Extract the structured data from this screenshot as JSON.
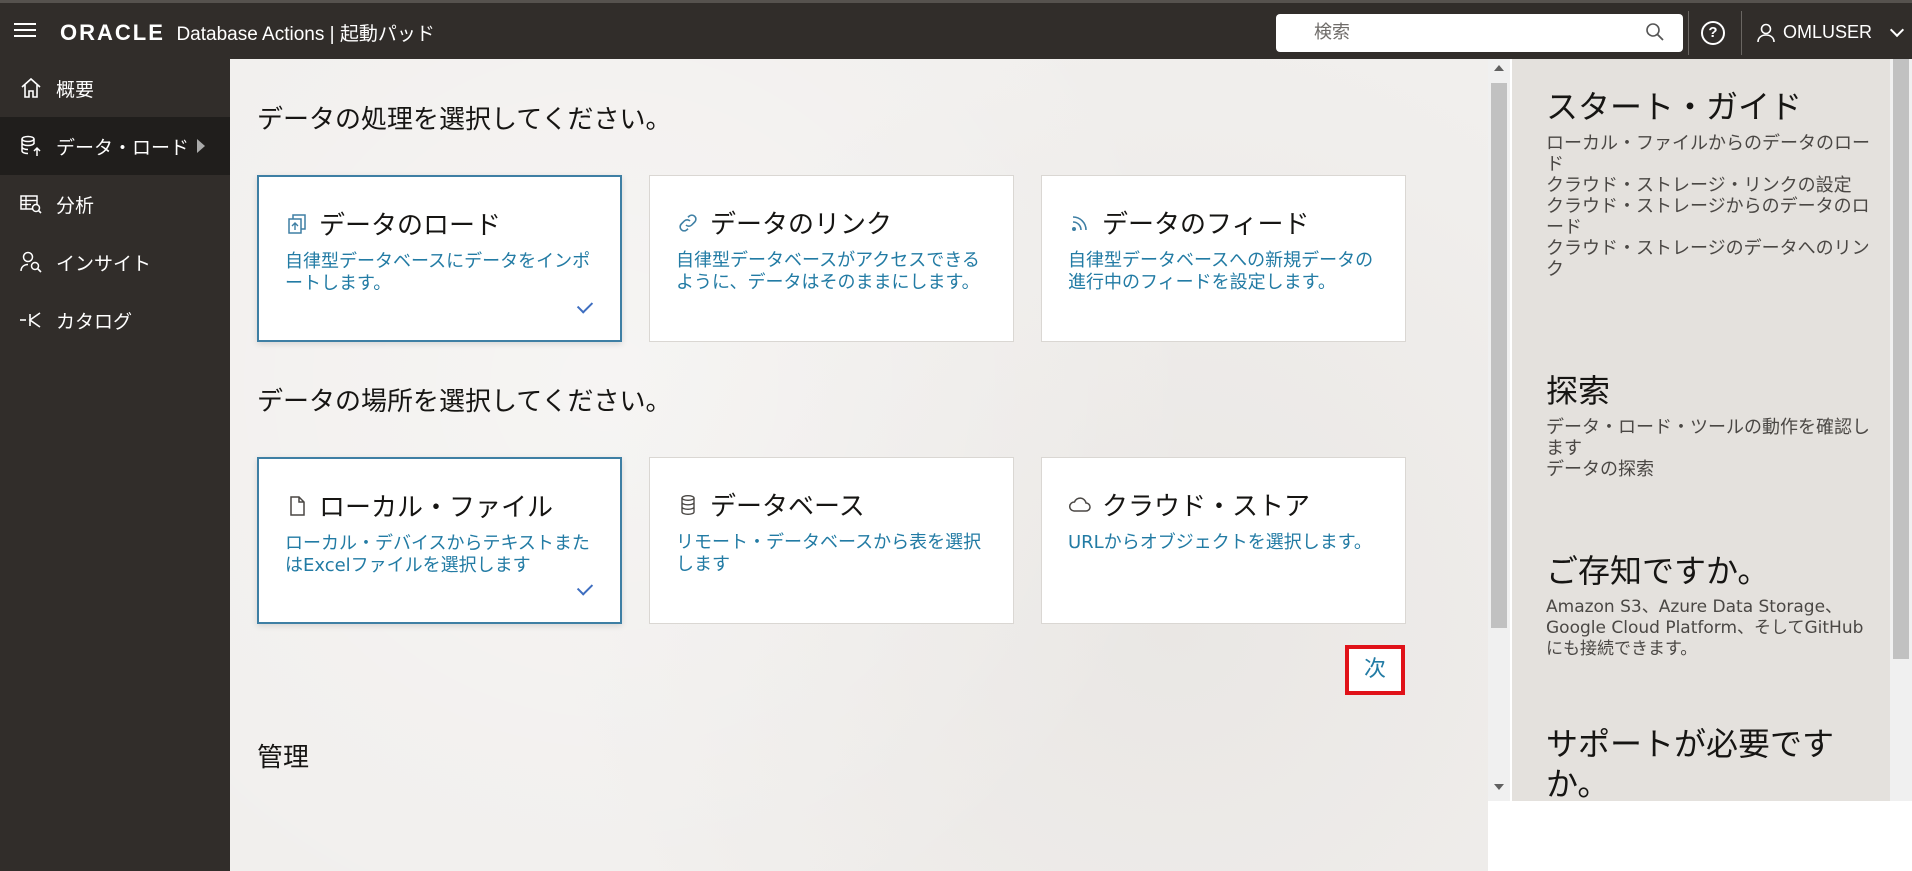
{
  "header": {
    "brand_logo": "ORACLE",
    "brand_sub": "Database Actions |  起動パッド",
    "search_placeholder": "検索",
    "help_label": "?",
    "user_name": "OMLUSER"
  },
  "sidebar": {
    "items": [
      {
        "label": "概要",
        "icon": "home-icon",
        "active": false
      },
      {
        "label": "データ・ロード",
        "icon": "database-upload-icon",
        "active": true
      },
      {
        "label": "分析",
        "icon": "analysis-icon",
        "active": false
      },
      {
        "label": "インサイト",
        "icon": "insight-icon",
        "active": false
      },
      {
        "label": "カタログ",
        "icon": "catalog-icon",
        "active": false
      }
    ],
    "collapse_label": "«"
  },
  "main": {
    "heading_process": "データの処理を選択してください。",
    "process_cards": [
      {
        "title": "データのロード",
        "desc": "自律型データベースにデータをインポートします。",
        "icon": "load-icon",
        "selected": true
      },
      {
        "title": "データのリンク",
        "desc": "自律型データベースがアクセスできるように、データはそのままにします。",
        "icon": "link-icon",
        "selected": false
      },
      {
        "title": "データのフィード",
        "desc": "自律型データベースへの新規データの進行中のフィードを設定します。",
        "icon": "feed-icon",
        "selected": false
      }
    ],
    "heading_location": "データの場所を選択してください。",
    "location_cards": [
      {
        "title": "ローカル・ファイル",
        "desc": "ローカル・デバイスからテキストまたはExcelファイルを選択します",
        "icon": "file-icon",
        "selected": true
      },
      {
        "title": "データベース",
        "desc": "リモート・データベースから表を選択します",
        "icon": "database-icon",
        "selected": false
      },
      {
        "title": "クラウド・ストア",
        "desc": "URLからオブジェクトを選択します。",
        "icon": "cloud-icon",
        "selected": false
      }
    ],
    "next_label": "次",
    "admin_heading": "管理"
  },
  "right_panel": {
    "getting_started": {
      "title": "スタート・ガイド",
      "links": [
        "ローカル・ファイルからのデータのロード",
        "クラウド・ストレージ・リンクの設定",
        "クラウド・ストレージからのデータのロード",
        "クラウド・ストレージのデータへのリンク"
      ]
    },
    "explore": {
      "title": "探索",
      "links": [
        "データ・ロード・ツールの動作を確認します",
        "データの探索"
      ]
    },
    "did_you_know": {
      "title": "ご存知ですか。",
      "text": "Amazon S3、Azure Data Storage、Google Cloud Platform、そしてGitHubにも接続できます。"
    },
    "need_help": {
      "title": "サポートが必要ですか。"
    }
  },
  "colors": {
    "header_bg": "#312d2a",
    "accent_link": "#227ba4",
    "selected_border": "#3e7fa4",
    "highlight_red": "#e01219"
  }
}
